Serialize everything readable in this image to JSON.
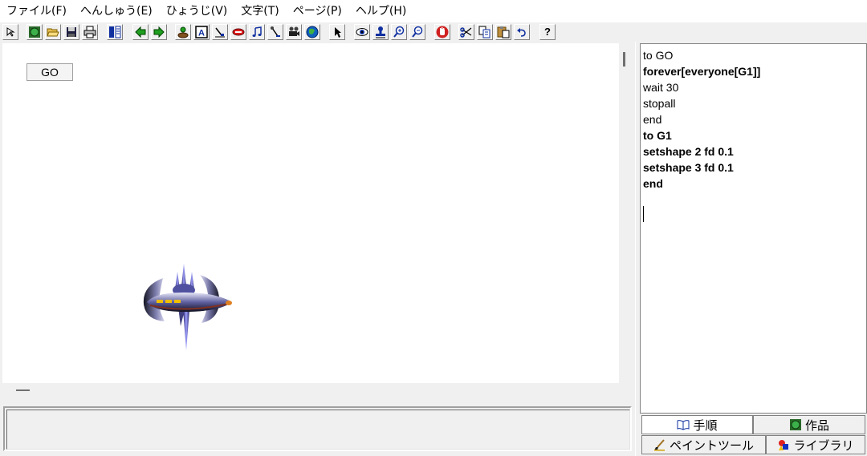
{
  "menu": {
    "items": [
      "ファイル(F)",
      "へんしゅう(E)",
      "ひょうじ(V)",
      "文字(T)",
      "ページ(P)",
      "ヘルプ(H)"
    ]
  },
  "toolbar": {
    "help_label": "?"
  },
  "canvas": {
    "go_button_label": "GO"
  },
  "procedures": {
    "lines": [
      {
        "text": "to GO",
        "bold": false
      },
      {
        "text": "forever[everyone[G1]]",
        "bold": true
      },
      {
        "text": "wait 30",
        "bold": false
      },
      {
        "text": "stopall",
        "bold": false
      },
      {
        "text": "end",
        "bold": false
      },
      {
        "text": "to G1",
        "bold": true
      },
      {
        "text": "setshape 2 fd 0.1",
        "bold": true
      },
      {
        "text": "setshape 3 fd 0.1",
        "bold": true
      },
      {
        "text": "end",
        "bold": true
      }
    ]
  },
  "tabs": {
    "procedures": "手順",
    "projects": "作品",
    "paint_tools": "ペイントツール",
    "library": "ライブラリ"
  }
}
